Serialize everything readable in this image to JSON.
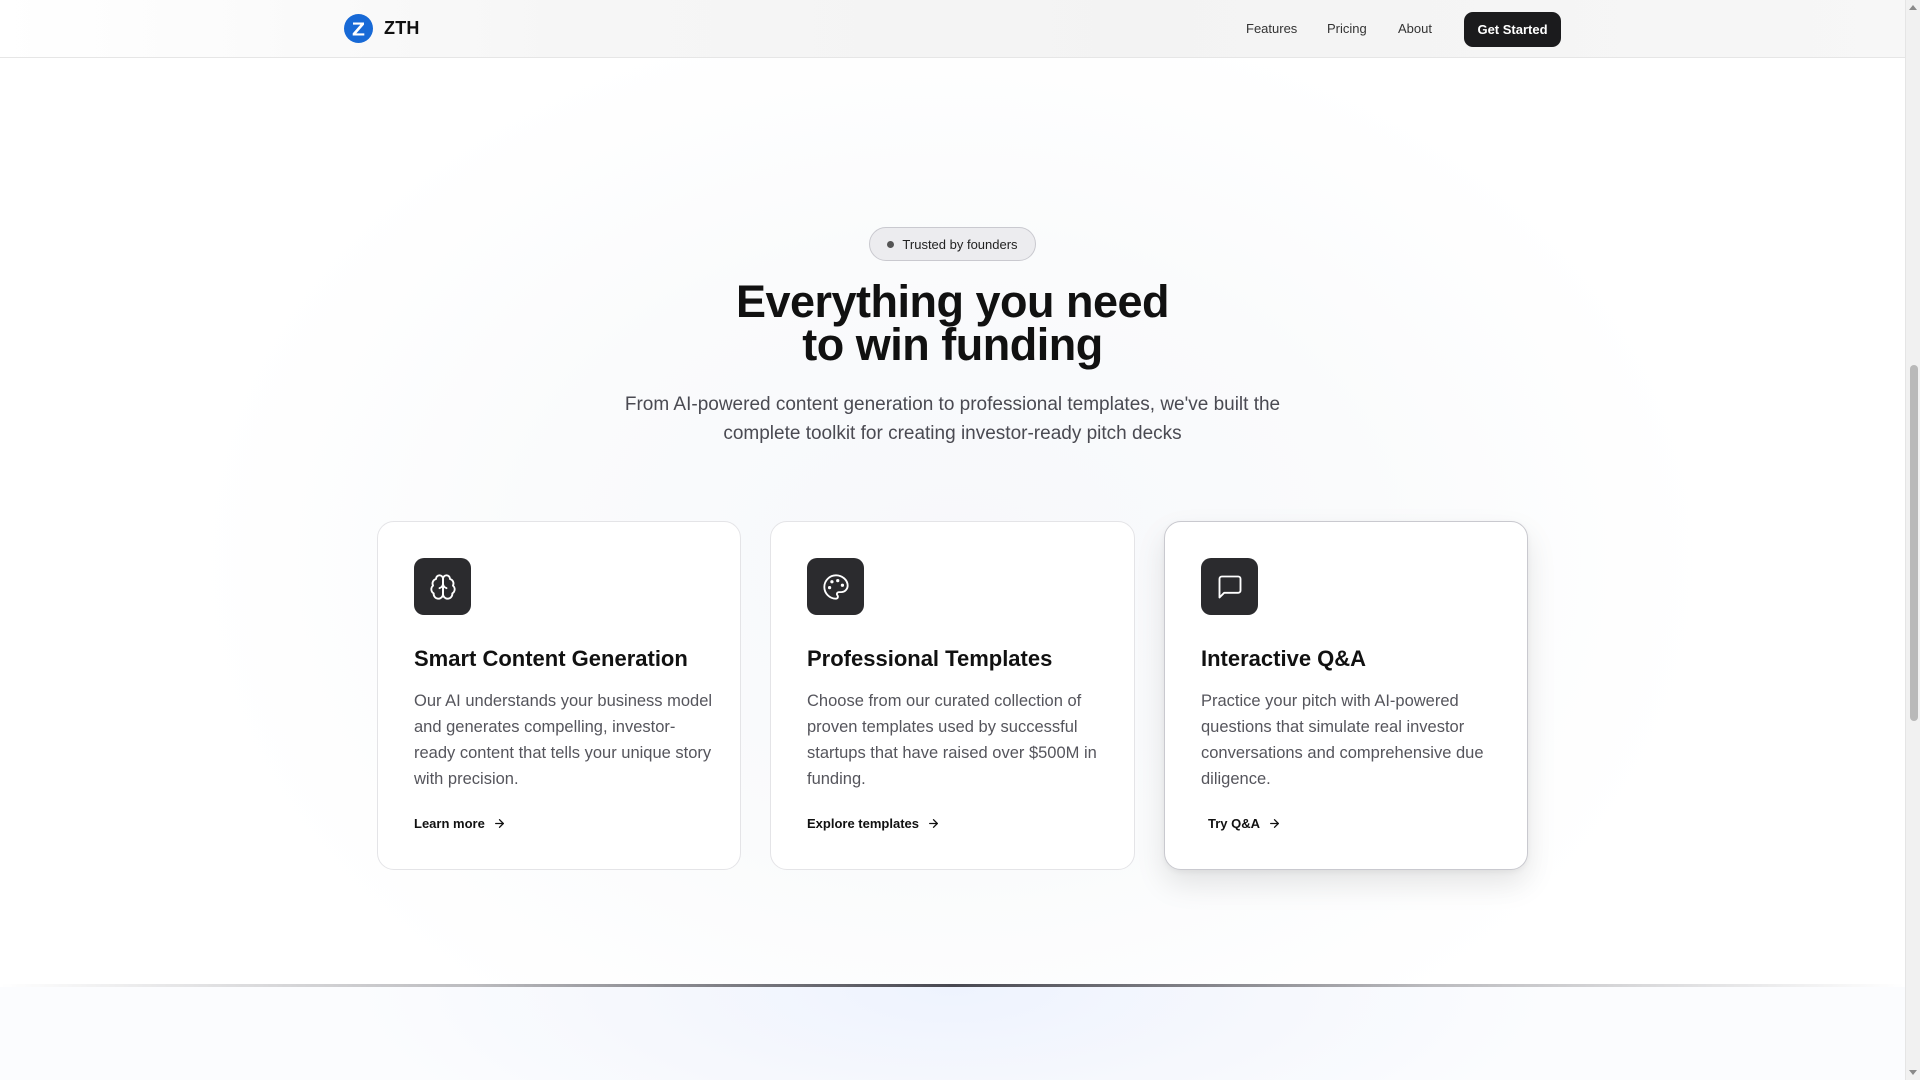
{
  "navbar": {
    "brand": "ZTH",
    "logo_letter": "Z",
    "links": [
      "Features",
      "Pricing",
      "About"
    ],
    "cta": "Get Started"
  },
  "hero": {
    "badge": "Trusted by founders",
    "headline_line1": "Everything you need",
    "headline_line2": "to win funding",
    "subhead_line1": "From AI-powered content generation to professional templates, we've built the",
    "subhead_line2": "complete toolkit for creating investor-ready pitch decks"
  },
  "cards": [
    {
      "icon": "brain-icon",
      "title": "Smart Content Generation",
      "description": "Our AI understands your business model and generates compelling, investor-ready content that tells your unique story with precision.",
      "link": "Learn more"
    },
    {
      "icon": "palette-icon",
      "title": "Professional Templates",
      "description": "Choose from our curated collection of proven templates used by successful startups that have raised over $500M in funding.",
      "link": "Explore templates"
    },
    {
      "icon": "message-square-icon",
      "title": "Interactive Q&A",
      "description": "Practice your pitch with AI-powered questions that simulate real investor conversations and comprehensive due diligence.",
      "link": "Try Q&A"
    }
  ],
  "colors": {
    "brand": "#1769d6",
    "cta_bg": "#1b1b1d",
    "icon_tile": "#2b2b2e"
  }
}
